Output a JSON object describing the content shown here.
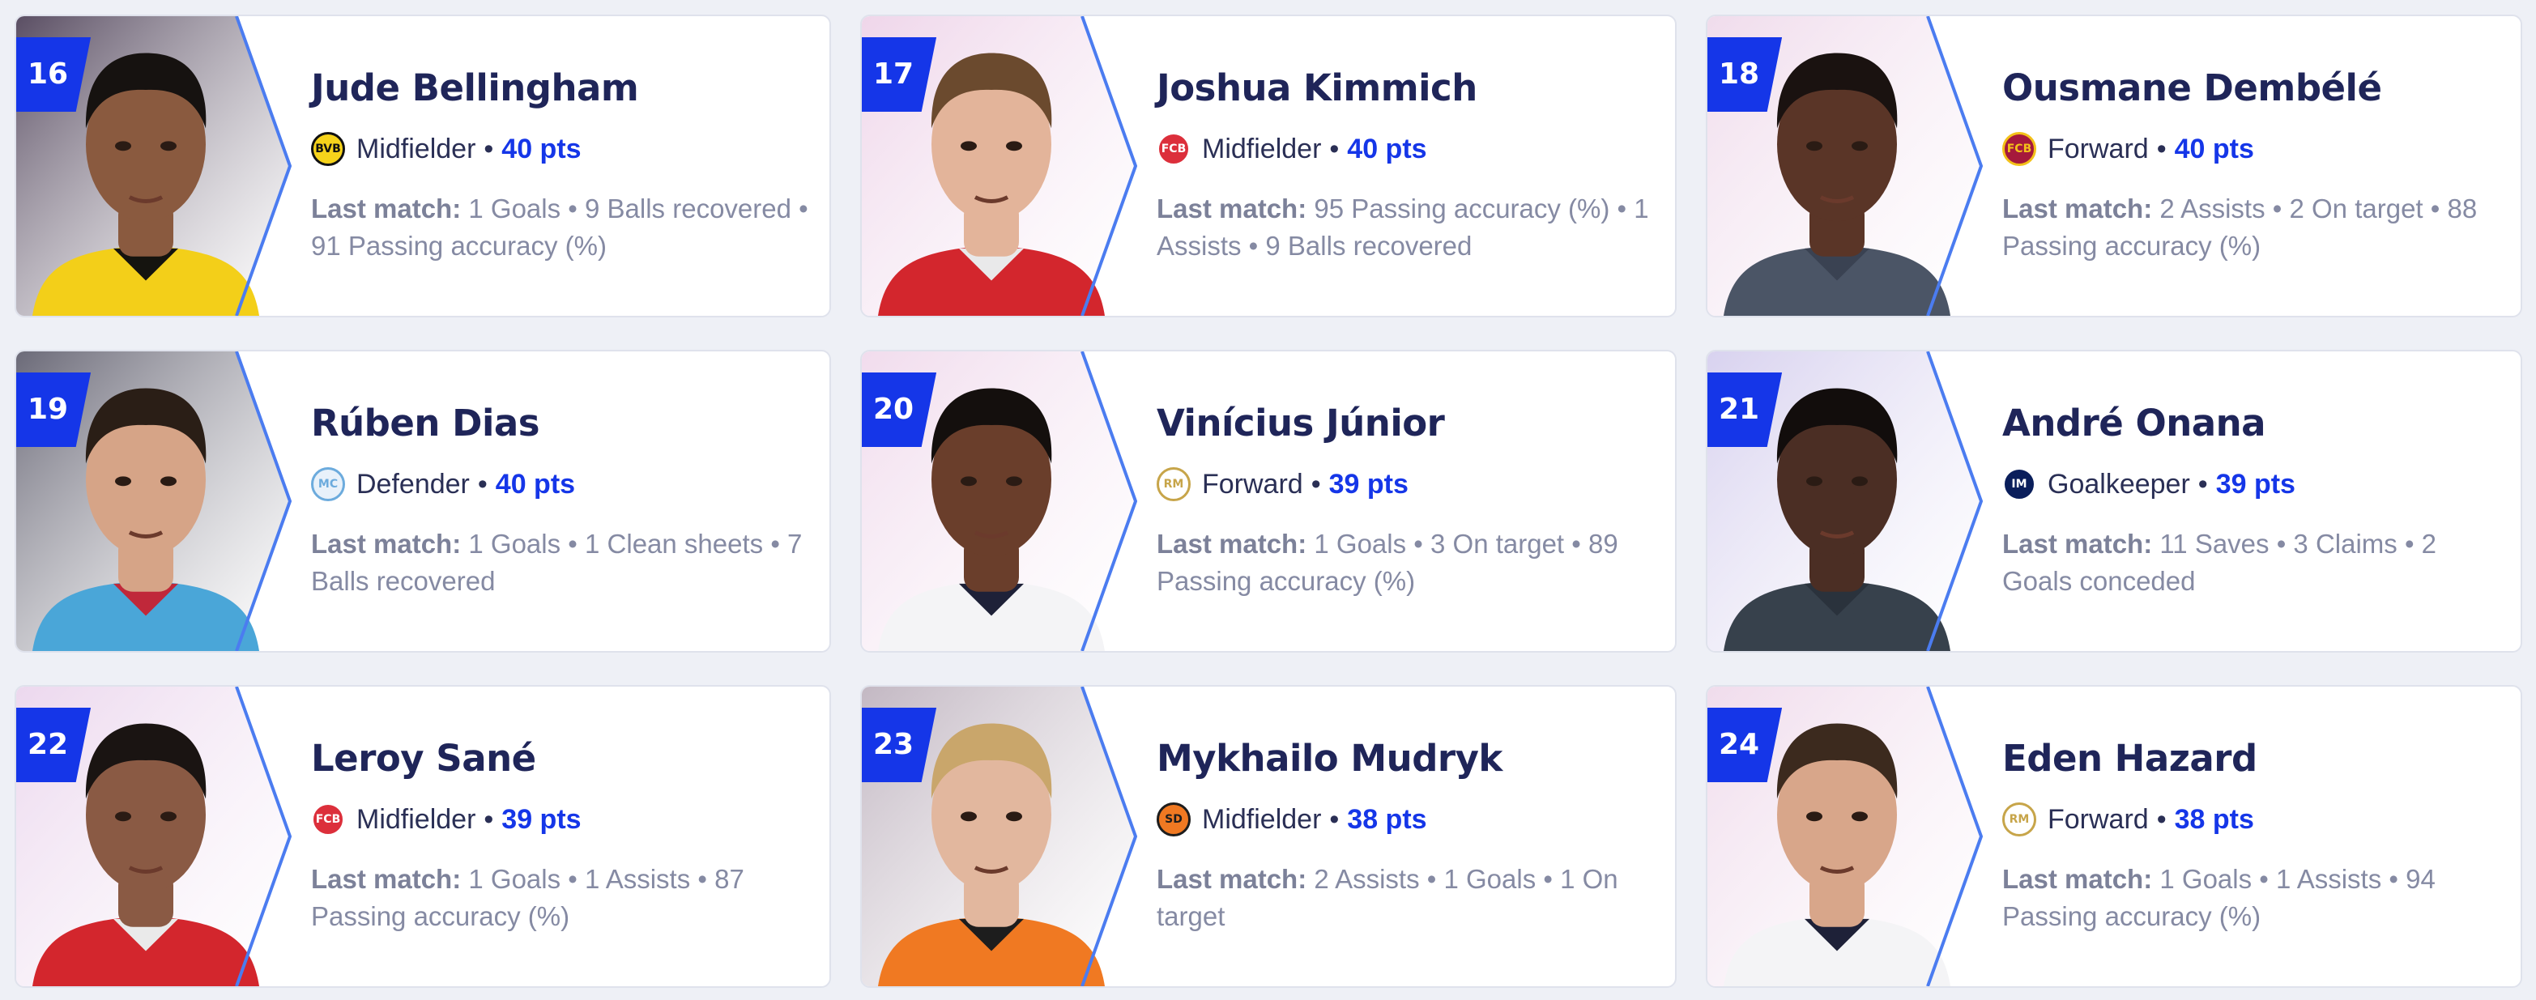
{
  "last_match_label": "Last match:",
  "players": [
    {
      "rank": "16",
      "name": "Jude Bellingham",
      "position": "Midfielder",
      "points": "40 pts",
      "stats": "1 Goals • 9 Balls recovered • 91 Passing accuracy (%)",
      "club_icon": "bvb-crest-icon",
      "bg": "#5a4e63",
      "skin": "#8a5a3f",
      "hair": "#161210",
      "shirt": "#f3cf19",
      "shirt2": "#15140f",
      "crest_bg": "#f6d31b",
      "crest_fg": "#111111",
      "crest_text": "BVB"
    },
    {
      "rank": "17",
      "name": "Joshua Kimmich",
      "position": "Midfielder",
      "points": "40 pts",
      "stats": "95 Passing accuracy (%) • 1 Assists • 9 Balls recovered",
      "club_icon": "fc-bayern-crest-icon",
      "bg": "#efd6ea",
      "skin": "#e3b49a",
      "hair": "#6b4a2e",
      "shirt": "#d3262d",
      "shirt2": "#e9e9ea",
      "crest_bg": "#dc2f3b",
      "crest_fg": "#ffffff",
      "crest_text": "FCB"
    },
    {
      "rank": "18",
      "name": "Ousmane Dembélé",
      "position": "Forward",
      "points": "40 pts",
      "stats": "2 Assists • 2 On target • 88 Passing accuracy (%)",
      "club_icon": "fc-barcelona-crest-icon",
      "bg": "#f0dcec",
      "skin": "#5a3527",
      "hair": "#1a1210",
      "shirt": "#4b5566",
      "shirt2": "#3a4252",
      "crest_bg": "#a5193c",
      "crest_fg": "#f3c119",
      "crest_text": "FCB"
    },
    {
      "rank": "19",
      "name": "Rúben Dias",
      "position": "Defender",
      "points": "40 pts",
      "stats": "1 Goals • 1 Clean sheets • 7 Balls recovered",
      "club_icon": "man-city-crest-icon",
      "bg": "#6b6a78",
      "skin": "#d6a487",
      "hair": "#2a1e16",
      "shirt": "#4aa6d8",
      "shirt2": "#c0283a",
      "crest_bg": "#e8f1fa",
      "crest_fg": "#6cabdd",
      "crest_text": "MC"
    },
    {
      "rank": "20",
      "name": "Vinícius Júnior",
      "position": "Forward",
      "points": "39 pts",
      "stats": "1 Goals • 3 On target • 89 Passing accuracy (%)",
      "club_icon": "real-madrid-crest-icon",
      "bg": "#f1dced",
      "skin": "#6a3e2b",
      "hair": "#140f0d",
      "shirt": "#f4f4f6",
      "shirt2": "#1e2138",
      "crest_bg": "#ffffff",
      "crest_fg": "#c7a54a",
      "crest_text": "RM"
    },
    {
      "rank": "21",
      "name": "André Onana",
      "position": "Goalkeeper",
      "points": "39 pts",
      "stats": "11 Saves • 3 Claims • 2 Goals conceded",
      "club_icon": "inter-crest-icon",
      "bg": "#d8d2ef",
      "skin": "#4b2e24",
      "hair": "#120d0c",
      "shirt": "#37414c",
      "shirt2": "#2a323c",
      "crest_bg": "#0a1e5b",
      "crest_fg": "#ffffff",
      "crest_text": "IM"
    },
    {
      "rank": "22",
      "name": "Leroy Sané",
      "position": "Midfielder",
      "points": "39 pts",
      "stats": "1 Goals • 1 Assists • 87 Passing accuracy (%)",
      "club_icon": "fc-bayern-crest-icon",
      "bg": "#ecd8ee",
      "skin": "#8a5a44",
      "hair": "#1a1412",
      "shirt": "#d3262d",
      "shirt2": "#eaeaea",
      "crest_bg": "#dc2f3b",
      "crest_fg": "#ffffff",
      "crest_text": "FCB"
    },
    {
      "rank": "23",
      "name": "Mykhailo Mudryk",
      "position": "Midfielder",
      "points": "38 pts",
      "stats": "2 Assists • 1 Goals • 1 On target",
      "club_icon": "shakhtar-crest-icon",
      "bg": "#c3b8c3",
      "skin": "#e2b79e",
      "hair": "#c9a66b",
      "shirt": "#f07922",
      "shirt2": "#1d1d1d",
      "crest_bg": "#f07922",
      "crest_fg": "#1d1d1d",
      "crest_text": "SD"
    },
    {
      "rank": "24",
      "name": "Eden Hazard",
      "position": "Forward",
      "points": "38 pts",
      "stats": "1 Goals • 1 Assists • 94 Passing accuracy (%)",
      "club_icon": "real-madrid-crest-icon",
      "bg": "#f0dcec",
      "skin": "#d8a68a",
      "hair": "#3c2a1e",
      "shirt": "#f4f4f6",
      "shirt2": "#1e2138",
      "crest_bg": "#ffffff",
      "crest_fg": "#c7a54a",
      "crest_text": "RM"
    }
  ]
}
